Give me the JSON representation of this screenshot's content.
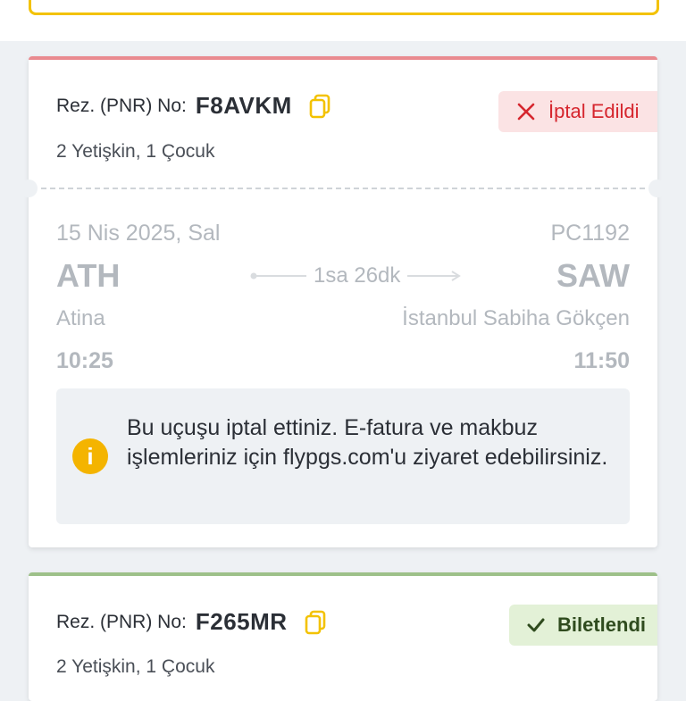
{
  "colors": {
    "cancel_accent": "#e98a8f",
    "cancel_text": "#d6262e",
    "ticketed_accent": "#9dc089",
    "info_icon": "#f4b400"
  },
  "bookings": [
    {
      "pnr_label": "Rez. (PNR) No:",
      "pnr_code": "F8AVKM",
      "passengers": "2 Yetişkin, 1 Çocuk",
      "status": "İptal Edildi",
      "status_icon": "close-icon",
      "flight": {
        "date": "15 Nis 2025, Sal",
        "flight_no": "PC1192",
        "from_code": "ATH",
        "to_code": "SAW",
        "duration": "1sa 26dk",
        "from_city": "Atina",
        "to_city": "İstanbul Sabiha Gökçen",
        "dep_time": "10:25",
        "arr_time": "11:50"
      },
      "notice": "Bu uçuşu iptal ettiniz. E-fatura ve makbuz işlemleriniz için flypgs.com'u ziyaret edebilirsiniz.",
      "notice_icon": "info-icon"
    },
    {
      "pnr_label": "Rez. (PNR) No:",
      "pnr_code": "F265MR",
      "passengers": "2 Yetişkin, 1 Çocuk",
      "status": "Biletlendi",
      "status_icon": "check-icon"
    }
  ]
}
